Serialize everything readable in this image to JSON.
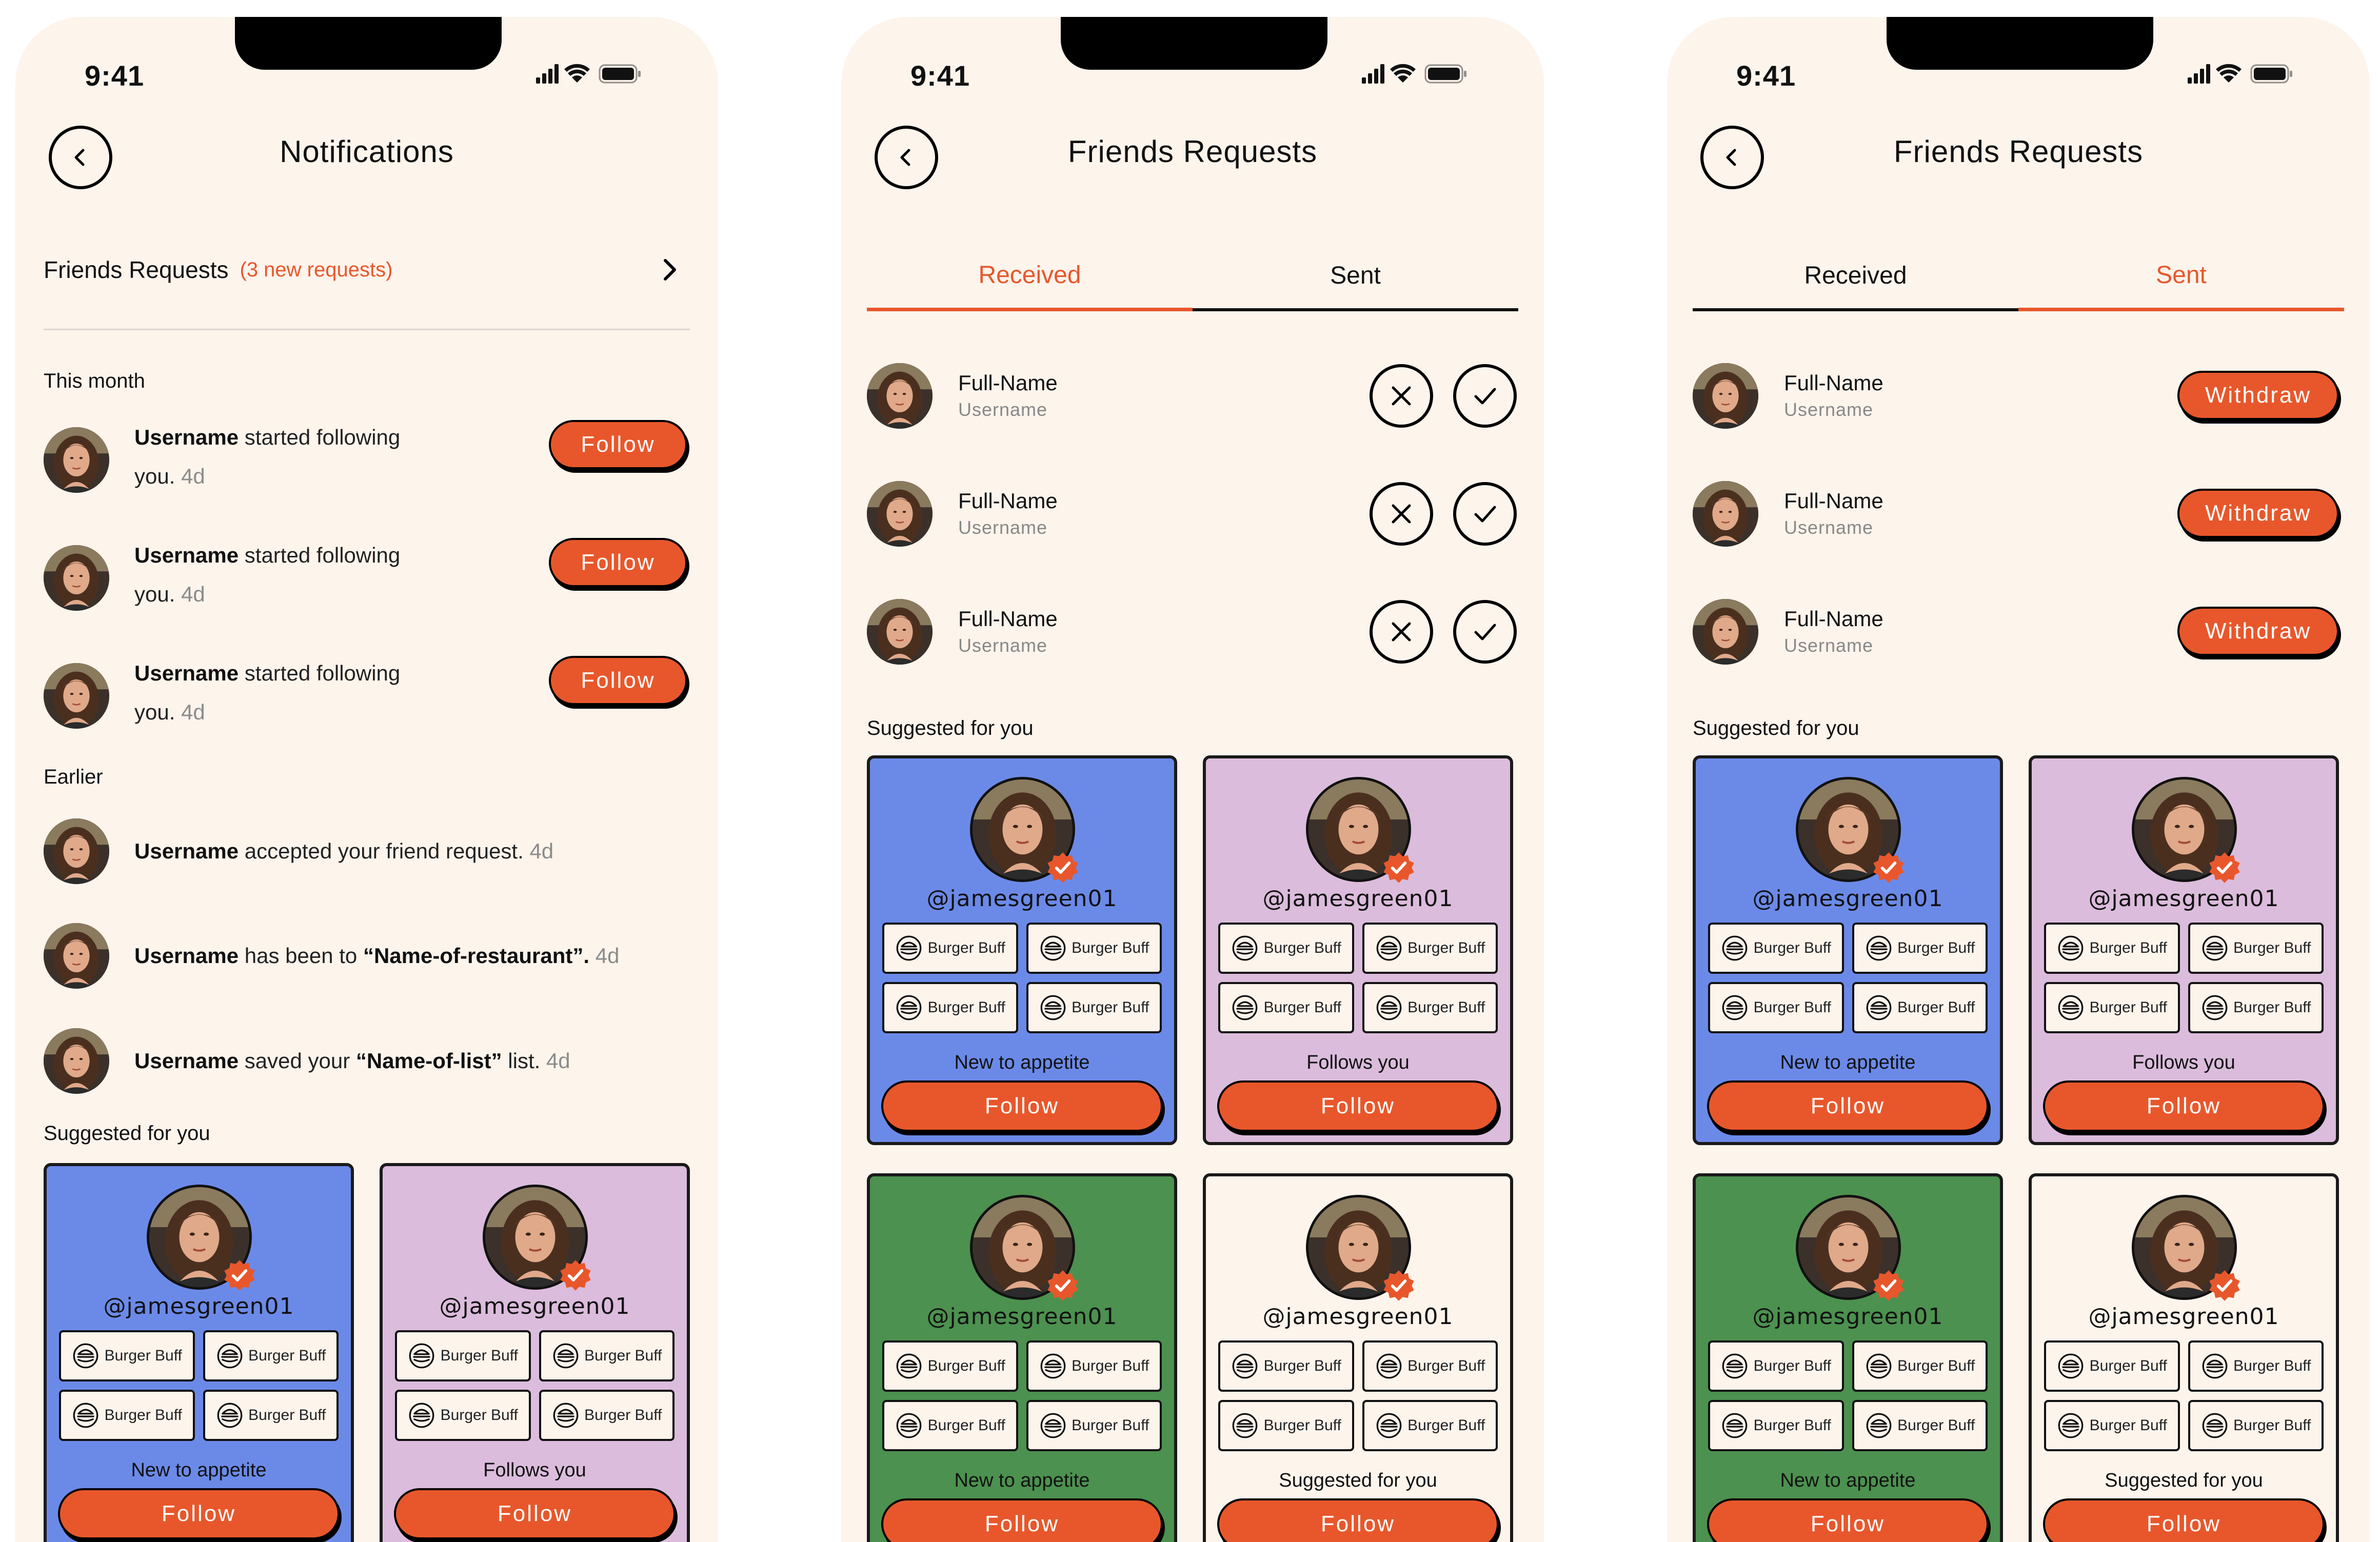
{
  "status": {
    "time": "9:41"
  },
  "colors": {
    "accent": "#e8572b",
    "background": "#fdf4ec",
    "blue_card": "#6b8ae8",
    "pink_card": "#dbbcdc",
    "green_card": "#4c914f"
  },
  "icons": {
    "back": "chevron-left-icon",
    "forward": "chevron-right-icon",
    "decline": "x-icon",
    "accept": "check-icon",
    "tag": "burger-icon",
    "verified": "verified-badge-icon"
  },
  "notifications_screen": {
    "title": "Notifications",
    "friends_requests": {
      "label": "Friends Requests",
      "count": "(3 new requests)"
    },
    "this_month": {
      "heading": "This month",
      "items": [
        {
          "user": "Username",
          "line1": " started following",
          "line2": "you.",
          "ago": "4d",
          "button": "Follow"
        },
        {
          "user": "Username",
          "line1": " started following",
          "line2": "you.",
          "ago": "4d",
          "button": "Follow"
        },
        {
          "user": "Username",
          "line1": " started following",
          "line2": "you.",
          "ago": "4d",
          "button": "Follow"
        }
      ]
    },
    "earlier": {
      "heading": "Earlier",
      "items": [
        {
          "user": "Username",
          "text": " accepted your friend request.",
          "ago": "4d"
        },
        {
          "user": "Username",
          "text": " has been to ",
          "bold2": "“Name-of-restaurant”.",
          "ago": "4d"
        },
        {
          "user": "Username",
          "text": " saved your ",
          "bold2": "“Name-of-list”",
          "text2": " list.",
          "ago": "4d"
        }
      ]
    },
    "suggested": {
      "heading": "Suggested for you",
      "cards": [
        {
          "handle": "@jamesgreen01",
          "tags": [
            "Burger Buff",
            "Burger Buff",
            "Burger Buff",
            "Burger Buff"
          ],
          "reason": "New to appetite",
          "button": "Follow"
        },
        {
          "handle": "@jamesgreen01",
          "tags": [
            "Burger Buff",
            "Burger Buff",
            "Burger Buff",
            "Burger Buff"
          ],
          "reason": "Follows you",
          "button": "Follow"
        }
      ]
    }
  },
  "received_screen": {
    "title": "Friends Requests",
    "tabs": [
      "Received",
      "Sent"
    ],
    "active_tab": "Received",
    "requests": [
      {
        "full_name": "Full-Name",
        "username": "Username"
      },
      {
        "full_name": "Full-Name",
        "username": "Username"
      },
      {
        "full_name": "Full-Name",
        "username": "Username"
      }
    ],
    "suggested": {
      "heading": "Suggested for you",
      "cards": [
        {
          "handle": "@jamesgreen01",
          "tags": [
            "Burger Buff",
            "Burger Buff",
            "Burger Buff",
            "Burger Buff"
          ],
          "reason": "New to appetite",
          "button": "Follow"
        },
        {
          "handle": "@jamesgreen01",
          "tags": [
            "Burger Buff",
            "Burger Buff",
            "Burger Buff",
            "Burger Buff"
          ],
          "reason": "Follows you",
          "button": "Follow"
        },
        {
          "handle": "@jamesgreen01",
          "tags": [
            "Burger Buff",
            "Burger Buff",
            "Burger Buff",
            "Burger Buff"
          ],
          "reason": "New to appetite",
          "button": "Follow"
        },
        {
          "handle": "@jamesgreen01",
          "tags": [
            "Burger Buff",
            "Burger Buff",
            "Burger Buff",
            "Burger Buff"
          ],
          "reason": "Suggested for you",
          "button": "Follow"
        }
      ]
    }
  },
  "sent_screen": {
    "title": "Friends Requests",
    "tabs": [
      "Received",
      "Sent"
    ],
    "active_tab": "Sent",
    "requests": [
      {
        "full_name": "Full-Name",
        "username": "Username",
        "button": "Withdraw"
      },
      {
        "full_name": "Full-Name",
        "username": "Username",
        "button": "Withdraw"
      },
      {
        "full_name": "Full-Name",
        "username": "Username",
        "button": "Withdraw"
      }
    ],
    "suggested": {
      "heading": "Suggested for you",
      "cards": [
        {
          "handle": "@jamesgreen01",
          "tags": [
            "Burger Buff",
            "Burger Buff",
            "Burger Buff",
            "Burger Buff"
          ],
          "reason": "New to appetite",
          "button": "Follow"
        },
        {
          "handle": "@jamesgreen01",
          "tags": [
            "Burger Buff",
            "Burger Buff",
            "Burger Buff",
            "Burger Buff"
          ],
          "reason": "Follows you",
          "button": "Follow"
        },
        {
          "handle": "@jamesgreen01",
          "tags": [
            "Burger Buff",
            "Burger Buff",
            "Burger Buff",
            "Burger Buff"
          ],
          "reason": "New to appetite",
          "button": "Follow"
        },
        {
          "handle": "@jamesgreen01",
          "tags": [
            "Burger Buff",
            "Burger Buff",
            "Burger Buff",
            "Burger Buff"
          ],
          "reason": "Suggested for you",
          "button": "Follow"
        }
      ]
    }
  }
}
